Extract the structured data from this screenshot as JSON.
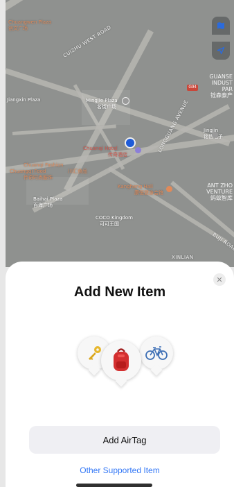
{
  "map": {
    "labels": {
      "top_left": "Chuangwen Plaza",
      "top_left_sub": "创文广场",
      "street_1": "CUIZHU WEST ROAD",
      "mongo": "Mingjie Plaza",
      "mongo_sub": "名街广场",
      "left_mid": "Jiangxin Plaza",
      "street_2": "LONGGUANG AVENUE",
      "red_place": "Chuanqi Hotel",
      "red_place_sub": "传奇酒店",
      "gold_mall": "Kangheng Hall",
      "gold_mall_sub": "康恒健身会馆",
      "orange_left": "Chuanqi Fashion",
      "orange_left_sub": "传奇时尚服饰",
      "block_left": "Baihai Plaza",
      "block_left_sub": "百海广场",
      "mall": "Chuangqi Food",
      "mall_sub": "川汇食品",
      "bottom_place": "COCO Kingdom",
      "bottom_place_sub": "可可王国",
      "right_top": "Jingjin",
      "right_top_sub": "铭信电子",
      "right_bottom": "XINLIAN",
      "road_bottom": "BUJI ROAD",
      "badge": "G94"
    },
    "districts": [
      {
        "line1": "GUANSE",
        "line2": "INDUST",
        "line3": "PAR",
        "line4": "铨森泰产"
      },
      {
        "line1": "ANT ZHO",
        "line2": "VENTURE",
        "line3": "蚂蚁智库",
        "line4": ""
      }
    ],
    "buttons": [
      {
        "icon": "map-icon"
      },
      {
        "icon": "location-arrow-icon"
      }
    ]
  },
  "sheet": {
    "title": "Add New Item",
    "close_icon": "close-icon",
    "items": [
      {
        "icon": "key-icon"
      },
      {
        "icon": "backpack-icon"
      },
      {
        "icon": "bicycle-icon"
      }
    ],
    "primary_button": "Add AirTag",
    "secondary_link": "Other Supported Item"
  },
  "colors": {
    "accent": "#3478f6",
    "location_dot": "#1e5bd8",
    "sheet_bg": "#ffffff",
    "button_bg": "#efeff3"
  }
}
